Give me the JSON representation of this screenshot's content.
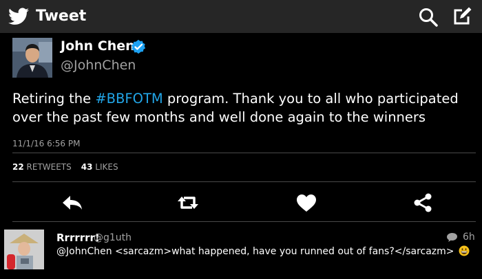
{
  "header": {
    "title": "Tweet",
    "left_icon": "twitter-bird-icon",
    "right_icons": [
      "search-icon",
      "compose-icon"
    ]
  },
  "tweet": {
    "author_name": "John Chen",
    "handle": "@JohnChen",
    "verified": true,
    "text_before": "Retiring the ",
    "hashtag": "#BBFOTM",
    "text_after": " program. Thank you to all who participated over the past few months and well done again to the winners",
    "timestamp": "11/1/16 6:56 PM",
    "retweets_count": "22",
    "retweets_label": "RETWEETS",
    "likes_count": "43",
    "likes_label": "LIKES"
  },
  "actions": [
    "reply-icon",
    "retweet-icon",
    "like-icon",
    "share-icon"
  ],
  "reply": {
    "name": "Rrrrrrr!",
    "handle": "@g1uth",
    "text": "@JohnChen <sarcazm>what happened, have you runned out of fans?</sarcazm>",
    "emoji": "grinning-face-emoji",
    "time": "6h"
  },
  "colors": {
    "accent": "#22a6e8",
    "header_bg": "#262626",
    "background": "#000000",
    "muted_text": "#a2a2a2"
  }
}
